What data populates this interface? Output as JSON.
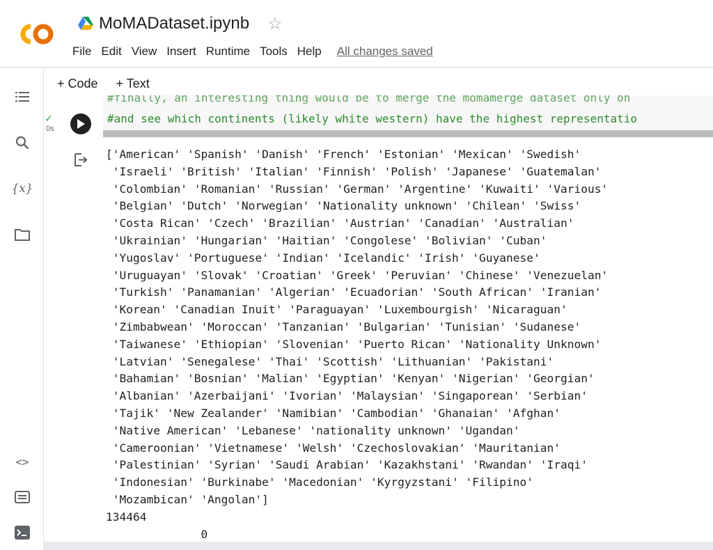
{
  "header": {
    "notebook_title": "MoMADataset.ipynb",
    "menu": [
      "File",
      "Edit",
      "View",
      "Insert",
      "Runtime",
      "Tools",
      "Help"
    ],
    "save_status": "All changes saved"
  },
  "toolbar": {
    "add_code": "+ Code",
    "add_text": "+ Text"
  },
  "sidebar": {
    "icons": [
      "table-of-contents-icon",
      "search-icon",
      "variables-icon",
      "files-icon",
      "code-snippets-icon",
      "command-palette-icon",
      "terminal-icon"
    ],
    "variables_label": "{x}"
  },
  "cell": {
    "comment_prev": "#finally, an interesting thing would be to merge the momamerge dataset only on",
    "comment": "#and see which continents (likely white western) have the highest representatio",
    "exec_time": "0s"
  },
  "output": {
    "lines": [
      "['American' 'Spanish' 'Danish' 'French' 'Estonian' 'Mexican' 'Swedish'",
      " 'Israeli' 'British' 'Italian' 'Finnish' 'Polish' 'Japanese' 'Guatemalan'",
      " 'Colombian' 'Romanian' 'Russian' 'German' 'Argentine' 'Kuwaiti' 'Various'",
      " 'Belgian' 'Dutch' 'Norwegian' 'Nationality unknown' 'Chilean' 'Swiss'",
      " 'Costa Rican' 'Czech' 'Brazilian' 'Austrian' 'Canadian' 'Australian'",
      " 'Ukrainian' 'Hungarian' 'Haitian' 'Congolese' 'Bolivian' 'Cuban'",
      " 'Yugoslav' 'Portuguese' 'Indian' 'Icelandic' 'Irish' 'Guyanese'",
      " 'Uruguayan' 'Slovak' 'Croatian' 'Greek' 'Peruvian' 'Chinese' 'Venezuelan'",
      " 'Turkish' 'Panamanian' 'Algerian' 'Ecuadorian' 'South African' 'Iranian'",
      " 'Korean' 'Canadian Inuit' 'Paraguayan' 'Luxembourgish' 'Nicaraguan'",
      " 'Zimbabwean' 'Moroccan' 'Tanzanian' 'Bulgarian' 'Tunisian' 'Sudanese'",
      " 'Taiwanese' 'Ethiopian' 'Slovenian' 'Puerto Rican' 'Nationality Unknown'",
      " 'Latvian' 'Senegalese' 'Thai' 'Scottish' 'Lithuanian' 'Pakistani'",
      " 'Bahamian' 'Bosnian' 'Malian' 'Egyptian' 'Kenyan' 'Nigerian' 'Georgian'",
      " 'Albanian' 'Azerbaijani' 'Ivorian' 'Malaysian' 'Singaporean' 'Serbian'",
      " 'Tajik' 'New Zealander' 'Namibian' 'Cambodian' 'Ghanaian' 'Afghan'",
      " 'Native American' 'Lebanese' 'nationality unknown' 'Ugandan'",
      " 'Cameroonian' 'Vietnamese' 'Welsh' 'Czechoslovakian' 'Mauritanian'",
      " 'Palestinian' 'Syrian' 'Saudi Arabian' 'Kazakhstani' 'Rwandan' 'Iraqi'",
      " 'Indonesian' 'Burkinabe' 'Macedonian' 'Kyrgyzstani' 'Filipino'",
      " 'Mozambican' 'Angolan']",
      "134464",
      "              0"
    ]
  }
}
